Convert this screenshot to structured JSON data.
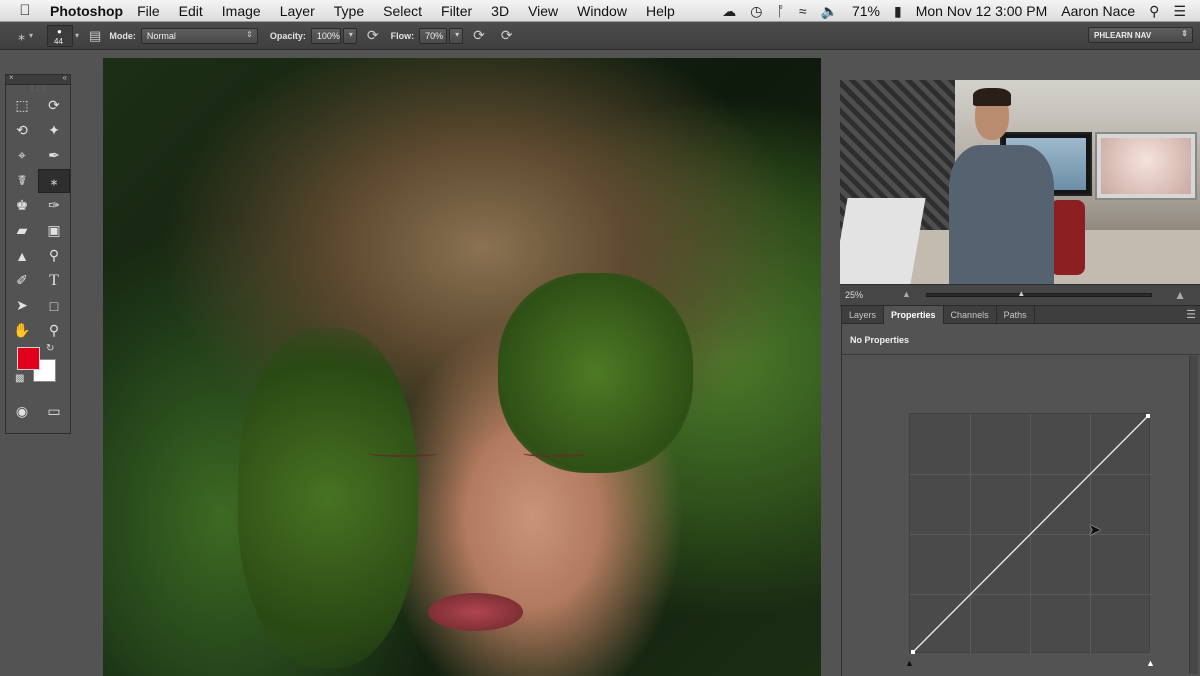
{
  "menubar": {
    "app_name": "Photoshop",
    "menus": [
      "File",
      "Edit",
      "Image",
      "Layer",
      "Type",
      "Select",
      "Filter",
      "3D",
      "View",
      "Window",
      "Help"
    ],
    "battery": "71%",
    "datetime": "Mon Nov 12  3:00 PM",
    "user": "Aaron Nace"
  },
  "options_bar": {
    "brush_size": "44",
    "mode_label": "Mode:",
    "mode_value": "Normal",
    "opacity_label": "Opacity:",
    "opacity_value": "100%",
    "flow_label": "Flow:",
    "flow_value": "70%",
    "workspace": "PHLEARN NAV"
  },
  "navigator": {
    "zoom": "25%"
  },
  "panel": {
    "tabs": [
      "Layers",
      "Properties",
      "Channels",
      "Paths"
    ],
    "active_tab": "Properties",
    "message": "No Properties"
  },
  "colors": {
    "foreground": "#e0001b",
    "background": "#ffffff",
    "ui_dark": "#535353"
  }
}
